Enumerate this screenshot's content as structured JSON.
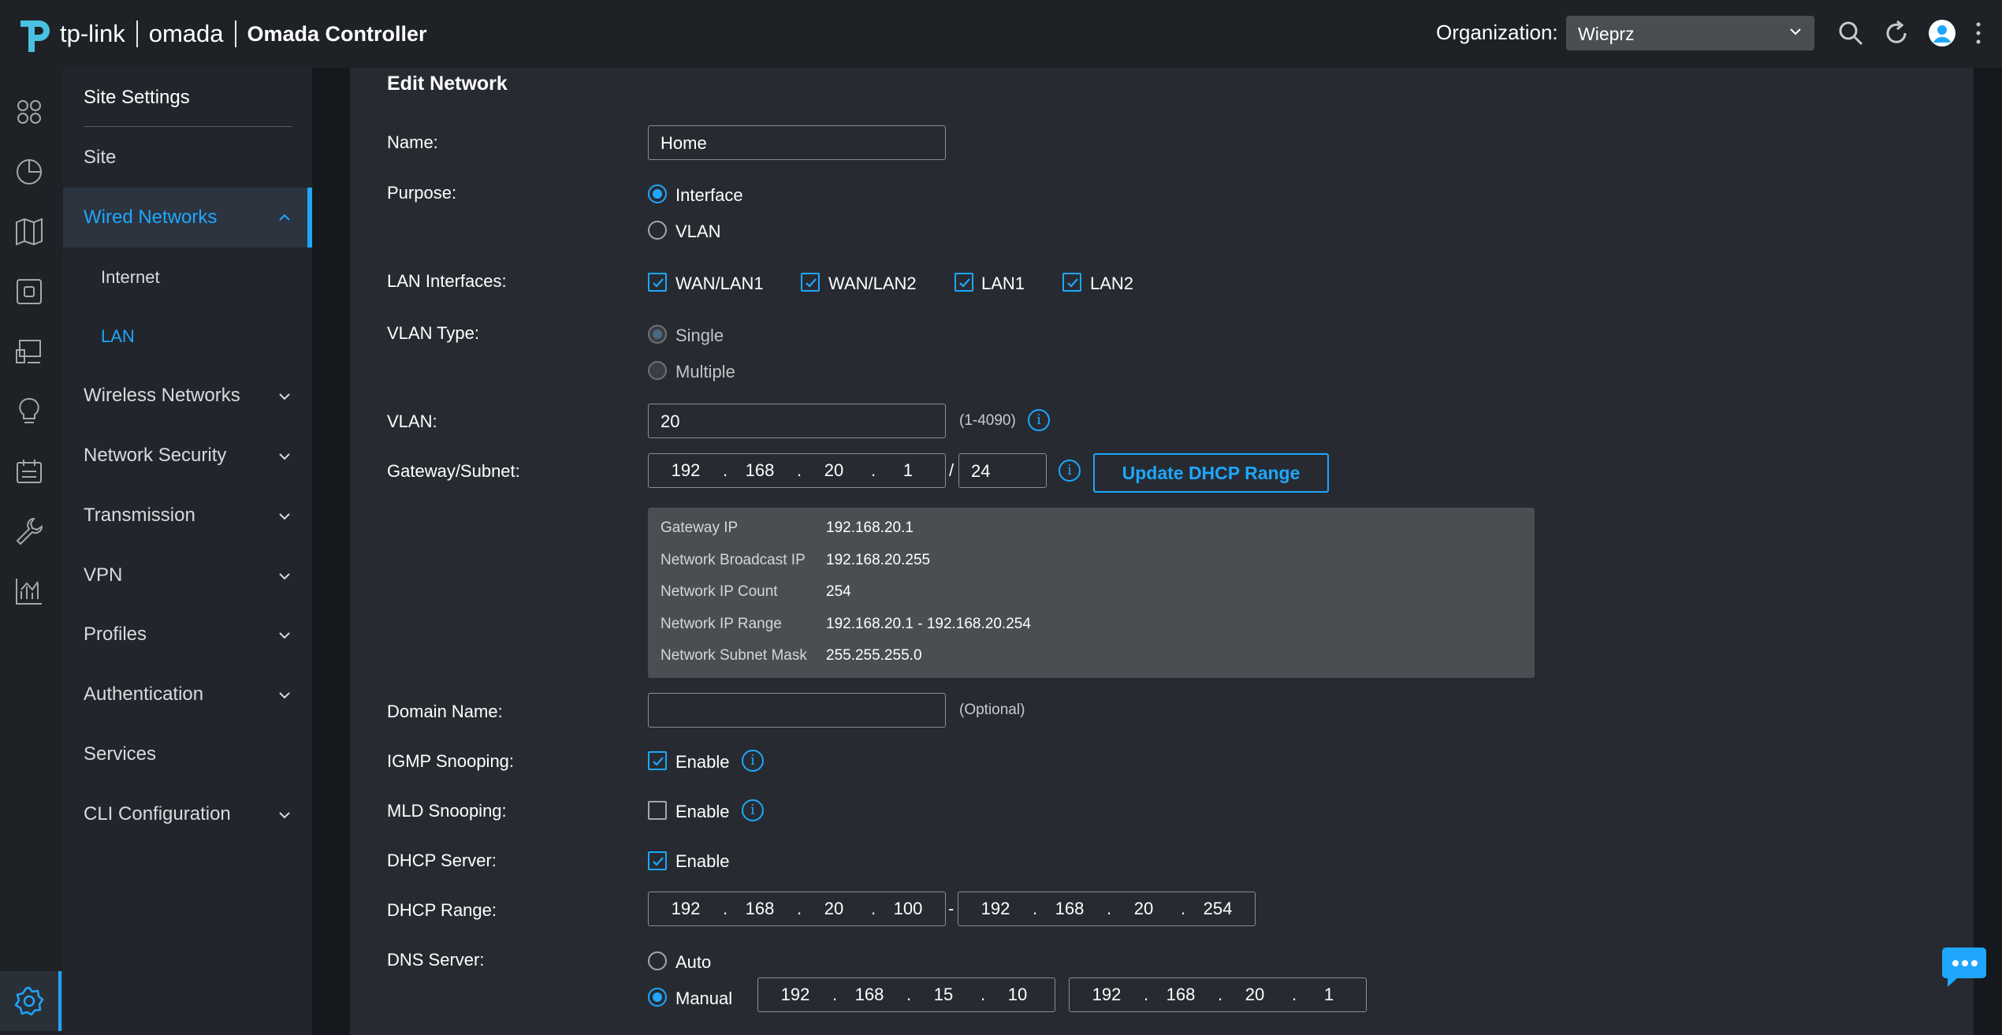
{
  "header": {
    "brand": "tp-link",
    "brand2": "omada",
    "product": "Omada Controller",
    "org_label": "Organization:",
    "org_value": "Wieprz"
  },
  "sidebar": {
    "title": "Site Settings",
    "items": [
      {
        "label": "Site"
      },
      {
        "label": "Wired Networks"
      },
      {
        "label": "Internet"
      },
      {
        "label": "LAN"
      },
      {
        "label": "Wireless Networks"
      },
      {
        "label": "Network Security"
      },
      {
        "label": "Transmission"
      },
      {
        "label": "VPN"
      },
      {
        "label": "Profiles"
      },
      {
        "label": "Authentication"
      },
      {
        "label": "Services"
      },
      {
        "label": "CLI Configuration"
      }
    ]
  },
  "form": {
    "title": "Edit Network",
    "name_label": "Name:",
    "name_value": "Home",
    "purpose_label": "Purpose:",
    "purpose_opt1": "Interface",
    "purpose_opt2": "VLAN",
    "lan_if_label": "LAN Interfaces:",
    "lan_if": [
      "WAN/LAN1",
      "WAN/LAN2",
      "LAN1",
      "LAN2"
    ],
    "vlan_type_label": "VLAN Type:",
    "vlan_type_opt1": "Single",
    "vlan_type_opt2": "Multiple",
    "vlan_label": "VLAN:",
    "vlan_value": "20",
    "vlan_hint": "(1-4090)",
    "gw_label": "Gateway/Subnet:",
    "gw": [
      "192",
      "168",
      "20",
      "1"
    ],
    "gw_slash": "/",
    "gw_mask": "24",
    "update_btn": "Update DHCP Range",
    "info": [
      {
        "k": "Gateway IP",
        "v": "192.168.20.1"
      },
      {
        "k": "Network Broadcast IP",
        "v": "192.168.20.255"
      },
      {
        "k": "Network IP Count",
        "v": "254"
      },
      {
        "k": "Network IP Range",
        "v": "192.168.20.1 - 192.168.20.254"
      },
      {
        "k": "Network Subnet Mask",
        "v": "255.255.255.0"
      }
    ],
    "domain_label": "Domain Name:",
    "domain_value": "",
    "domain_hint": "(Optional)",
    "igmp_label": "IGMP Snooping:",
    "mld_label": "MLD Snooping:",
    "dhcp_label": "DHCP Server:",
    "enable": "Enable",
    "dhcp_range_label": "DHCP Range:",
    "dhcp_start": [
      "192",
      "168",
      "20",
      "100"
    ],
    "dhcp_dash": "-",
    "dhcp_end": [
      "192",
      "168",
      "20",
      "254"
    ],
    "dns_label": "DNS Server:",
    "dns_opt1": "Auto",
    "dns_opt2": "Manual",
    "dns1": [
      "192",
      "168",
      "15",
      "10"
    ],
    "dns2": [
      "192",
      "168",
      "20",
      "1"
    ],
    "dot": "."
  },
  "colors": {
    "accent": "#1ea7fd",
    "bg": "#1e2227",
    "panel": "#272b31",
    "infobox": "#4a4d52"
  }
}
